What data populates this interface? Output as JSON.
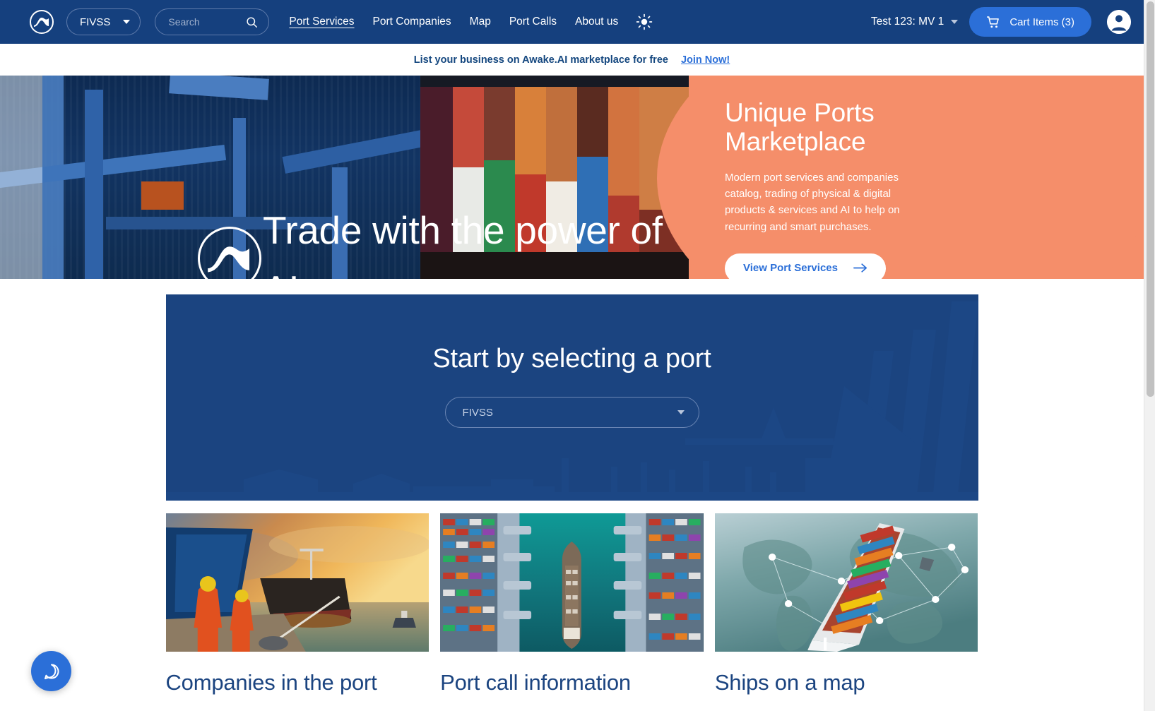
{
  "header": {
    "logo_name": "awake-ai-logo",
    "port_selector": {
      "value": "FIVSS"
    },
    "search": {
      "placeholder": "Search",
      "value": ""
    },
    "nav": [
      {
        "label": "Port Services",
        "active": true
      },
      {
        "label": "Port Companies",
        "active": false
      },
      {
        "label": "Map",
        "active": false
      },
      {
        "label": "Port Calls",
        "active": false
      },
      {
        "label": "About us",
        "active": false
      }
    ],
    "theme_toggle_icon": "sun-icon",
    "vessel_selector": {
      "label": "Test 123: MV 1"
    },
    "cart": {
      "label": "Cart Items (3)",
      "icon": "shopping-cart-icon",
      "count": 3
    },
    "account": {
      "icon": "account-circle-icon"
    },
    "bg_color": "#15407e"
  },
  "promo": {
    "text": "List your business on Awake.AI marketplace for free",
    "link_label": "Join Now!",
    "link_color": "#2b6fd8"
  },
  "hero": {
    "overlay_headline": "Trade with the power of AI",
    "watermark_icon": "awake-ai-logo",
    "title": "Unique Ports Marketplace",
    "body": "Modern port services and companies catalog, trading of physical & digital products & services and AI to help on recurring and smart purchases.",
    "cta_label": "View Port Services",
    "cta_icon": "arrow-right-icon",
    "panel_color": "#f58e6a",
    "cta_text_color": "#2b6fd8"
  },
  "port_panel": {
    "title": "Start by selecting a port",
    "dropdown": {
      "value": "FIVSS",
      "icon": "chevron-down-icon"
    },
    "bg_color": "#1b4480"
  },
  "cards": [
    {
      "title": "Companies in the port",
      "image_name": "port-workers-at-sunset-photo"
    },
    {
      "title": "Port call information",
      "image_name": "aerial-container-terminal-photo"
    },
    {
      "title": "Ships on a map",
      "image_name": "container-ship-world-map-photo"
    }
  ],
  "chat_widget": {
    "icon": "chat-bubble-icon",
    "color": "#2b6fd8"
  },
  "scrollbar": {
    "name": "page-scrollbar"
  }
}
